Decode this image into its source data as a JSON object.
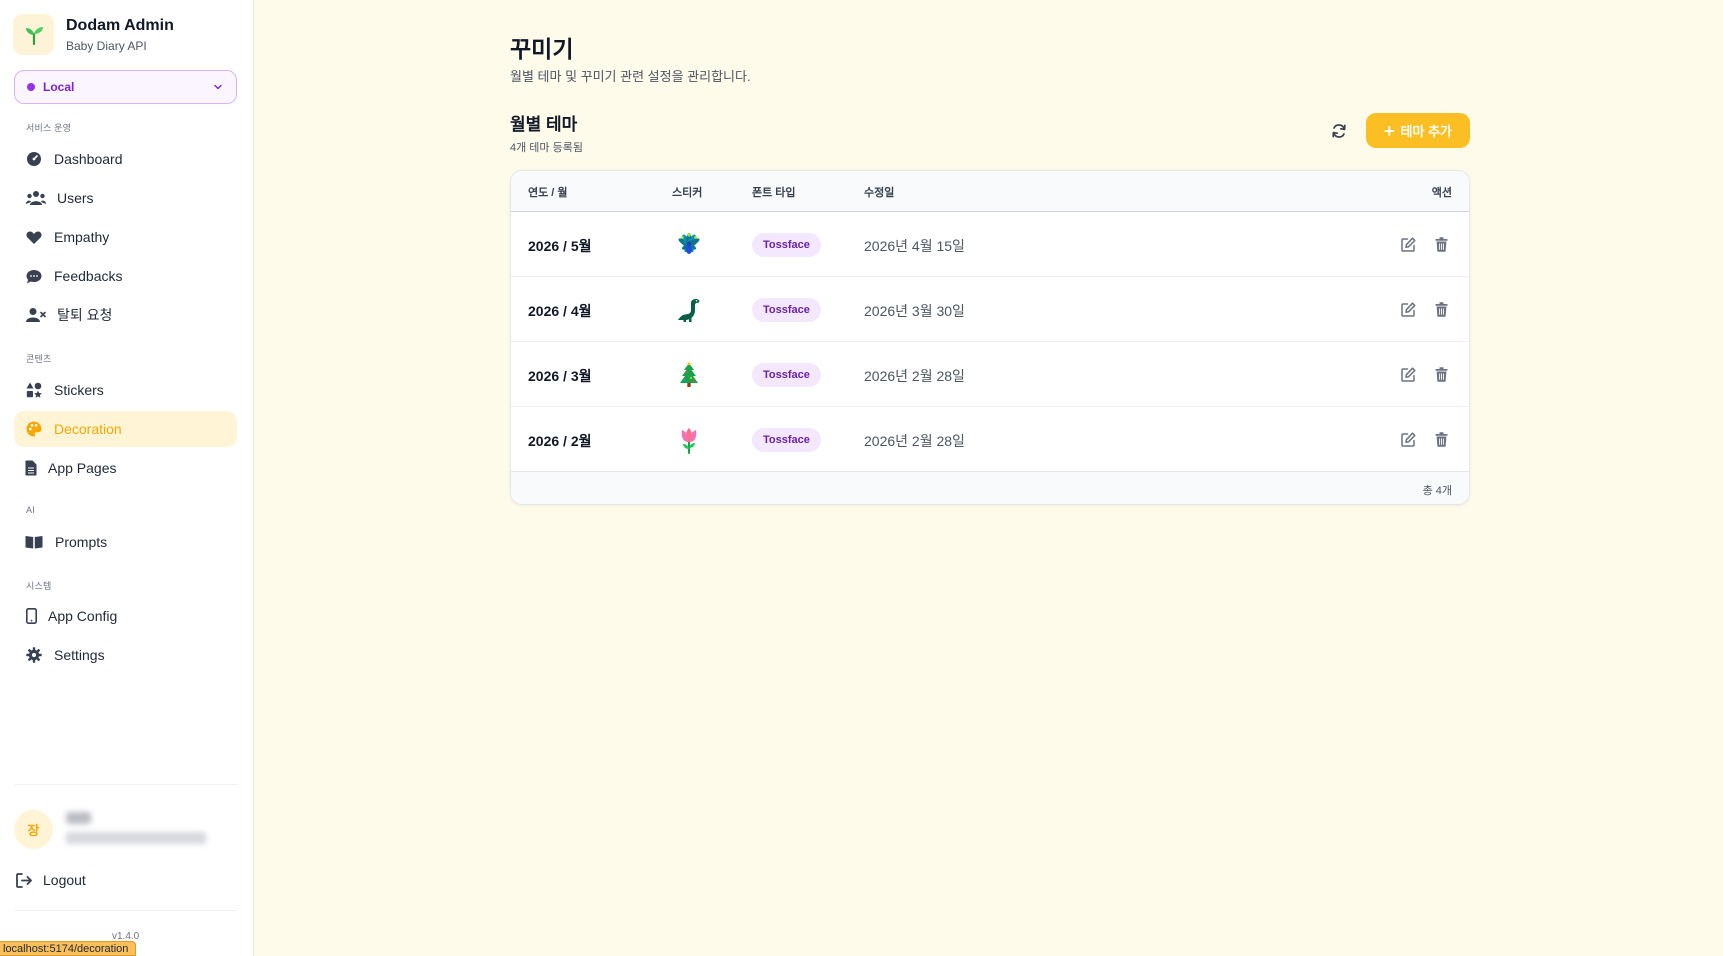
{
  "brand": {
    "title": "Dodam Admin",
    "subtitle": "Baby Diary API"
  },
  "env_select": {
    "value": "Local"
  },
  "sections": {
    "service": "서비스 운영",
    "content": "콘텐츠",
    "ai": "AI",
    "system": "시스템"
  },
  "nav": {
    "dashboard": "Dashboard",
    "users": "Users",
    "empathy": "Empathy",
    "feedbacks": "Feedbacks",
    "withdrawal": "탈퇴 요청",
    "stickers": "Stickers",
    "decoration": "Decoration",
    "app_pages": "App Pages",
    "prompts": "Prompts",
    "app_config": "App Config",
    "settings": "Settings"
  },
  "user": {
    "avatar_initial": "장"
  },
  "logout_label": "Logout",
  "version": "v1.4.0",
  "status_url": "localhost:5174/decoration",
  "page": {
    "title": "꾸미기",
    "description": "월별 테마 및 꾸미기 관련 설정을 관리합니다."
  },
  "themes_section": {
    "title": "월별 테마",
    "subtitle": "4개 테마 등록됨",
    "add_label": "테마 추가"
  },
  "table": {
    "headers": {
      "date": "연도 / 월",
      "sticker": "스티커",
      "font": "폰트 타입",
      "updated": "수정일",
      "actions": "액션"
    },
    "rows": [
      {
        "date": "2026 / 5월",
        "sticker": "peacock-icon",
        "font": "Tossface",
        "updated": "2026년 4월 15일"
      },
      {
        "date": "2026 / 4월",
        "sticker": "dinosaur-icon",
        "font": "Tossface",
        "updated": "2026년 3월 30일"
      },
      {
        "date": "2026 / 3월",
        "sticker": "christmas-tree-icon",
        "font": "Tossface",
        "updated": "2026년 2월 28일"
      },
      {
        "date": "2026 / 2월",
        "sticker": "tulip-icon",
        "font": "Tossface",
        "updated": "2026년 2월 28일"
      }
    ],
    "footer": "총 4개"
  },
  "colors": {
    "accent": "#fbbf24",
    "active_text": "#f5a800",
    "badge_bg": "#f3e8ff",
    "badge_text": "#6b21a8",
    "env": "#9333ea"
  }
}
